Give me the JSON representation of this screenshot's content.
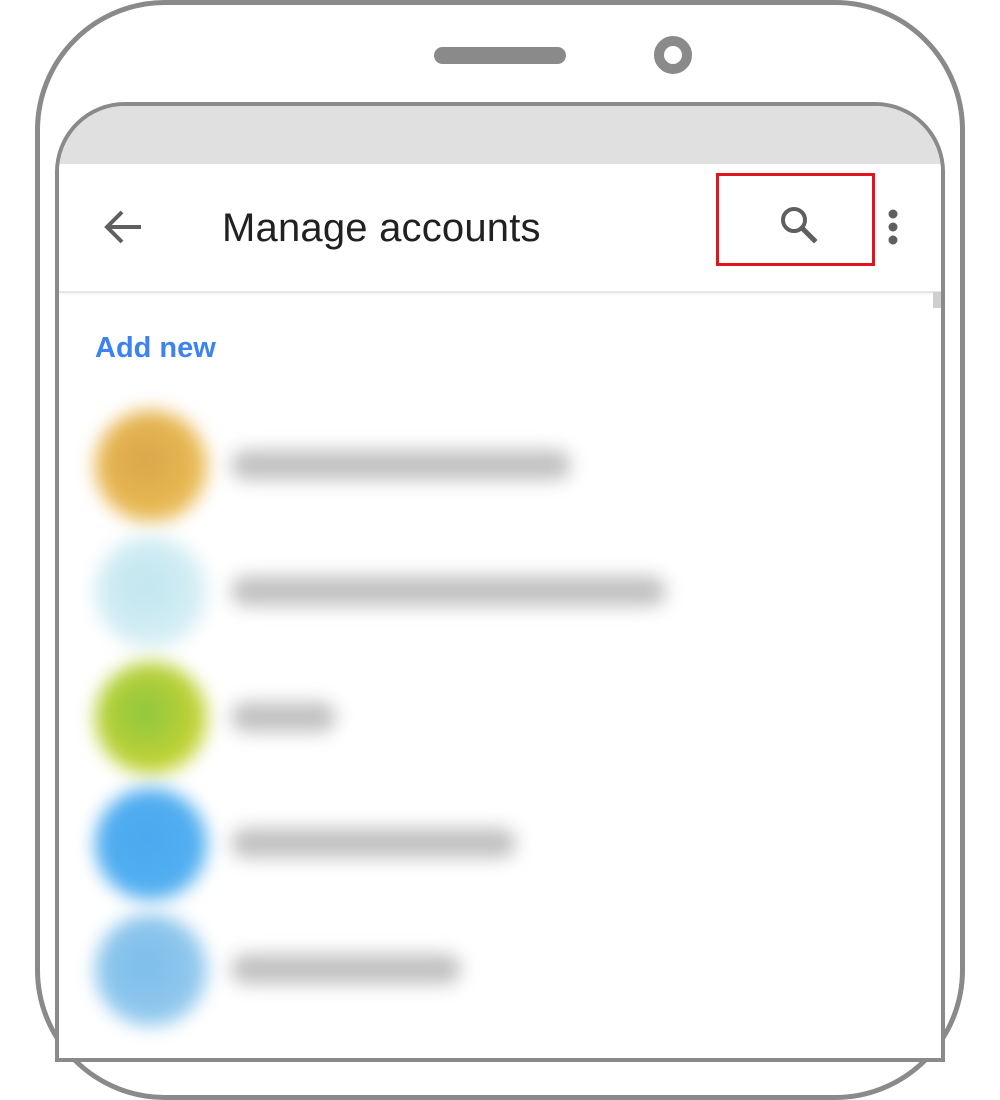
{
  "app": {
    "title": "Manage accounts",
    "add_new_label": "Add new"
  },
  "icons": {
    "back": "arrow-back-icon",
    "search": "search-icon",
    "more": "more-vertical-icon"
  },
  "highlight_color": "#e3141c",
  "accent_color": "#3d83f0",
  "accounts": [
    {
      "avatar_color": "#d9a54a",
      "avatar_color_2": "#f3c75a"
    },
    {
      "avatar_color": "#bfe5ef",
      "avatar_color_2": "#e4f4f8"
    },
    {
      "avatar_color": "#8cc63f",
      "avatar_color_2": "#e2da2f"
    },
    {
      "avatar_color": "#4aa8ee",
      "avatar_color_2": "#57b3f2"
    },
    {
      "avatar_color": "#7cbde9",
      "avatar_color_2": "#9fd0f0"
    }
  ]
}
